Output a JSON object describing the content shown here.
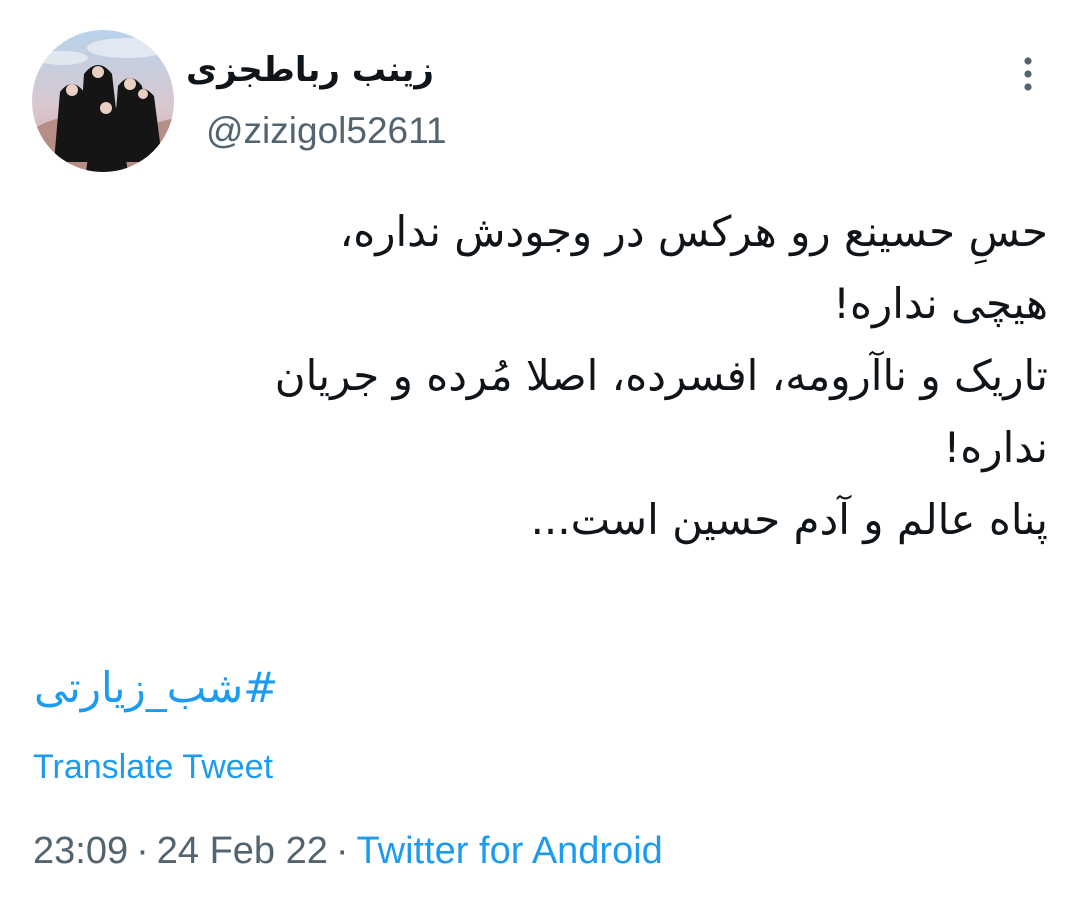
{
  "author": {
    "display_name": "زینب رباطجزی",
    "username": "@zizigol52611"
  },
  "tweet": {
    "lines": [
      "حسِ حسینع رو هرکس در وجودش نداره،",
      "هیچی نداره!",
      "تاریک و ناآرومه، افسرده، اصلا مُرده و جریان",
      "نداره!",
      "پناه عالم و آدم حسین است..."
    ],
    "hashtag": "#شب_زیارتی"
  },
  "translate_label": "Translate Tweet",
  "meta": {
    "time": "23:09",
    "separator": "·",
    "date": "24 Feb 22",
    "source": "Twitter for Android"
  },
  "icons": {
    "more": "more-vertical-icon"
  },
  "colors": {
    "link": "#1d9bf0",
    "secondary_text": "#536471",
    "primary_text": "#0f1419"
  }
}
